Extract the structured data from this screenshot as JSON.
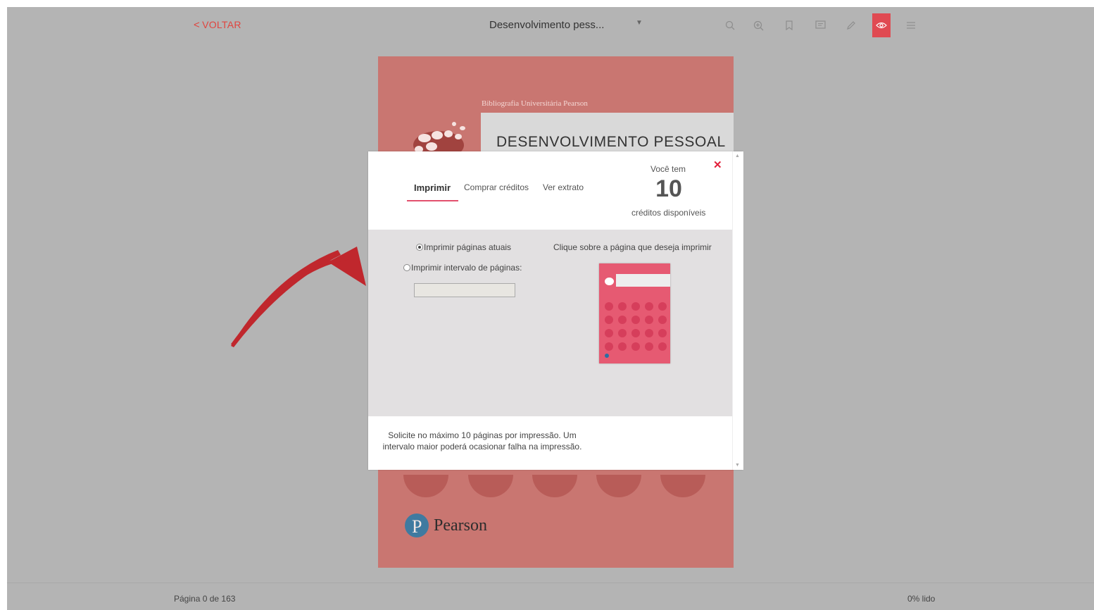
{
  "toolbar": {
    "back_label": "VOLTAR",
    "doc_title": "Desenvolvimento pess...",
    "tools": [
      "search-icon",
      "zoom-in-icon",
      "bookmark-icon",
      "notes-icon",
      "pencil-icon",
      "eye-icon",
      "menu-icon"
    ]
  },
  "page": {
    "series": "Bibliografia Universitária Pearson",
    "title": "DESENVOLVIMENTO PESSOAL",
    "publisher": "Pearson"
  },
  "modal": {
    "tabs": [
      {
        "label": "Imprimir",
        "active": true
      },
      {
        "label": "Comprar créditos",
        "active": false
      },
      {
        "label": "Ver extrato",
        "active": false
      }
    ],
    "credits_label": "Você tem",
    "credits_value": "10",
    "credits_sub": "créditos disponíveis",
    "option_current": "Imprimir páginas atuais",
    "option_range": "Imprimir intervalo de páginas:",
    "range_value": "",
    "click_hint": "Clique sobre a página que deseja imprimir",
    "footer_note": "Solicite no máximo 10 páginas por impressão. Um intervalo maior poderá ocasionar falha na impressão."
  },
  "statusbar": {
    "page_info": "Página 0 de 163",
    "read_info": "0% lido"
  },
  "colors": {
    "accent": "#e04a52",
    "tab_underline": "#e2506d",
    "arrow": "#c0272d"
  }
}
